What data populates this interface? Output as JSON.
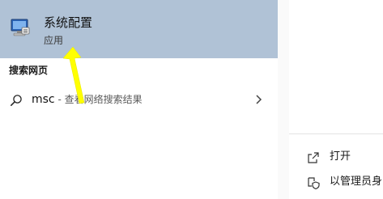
{
  "best_match": {
    "title": "系统配置",
    "type": "应用",
    "icon": "system-config-app-icon"
  },
  "web_section": {
    "label": "搜索网页",
    "query": "msc",
    "hint": " - 查看网络搜索结果"
  },
  "actions": [
    {
      "label": "打开",
      "icon": "open-icon"
    },
    {
      "label": "以管理员身",
      "icon": "admin-shield-icon"
    }
  ],
  "colors": {
    "highlight": "#b0c2d6",
    "arrow": "#ffff00"
  }
}
